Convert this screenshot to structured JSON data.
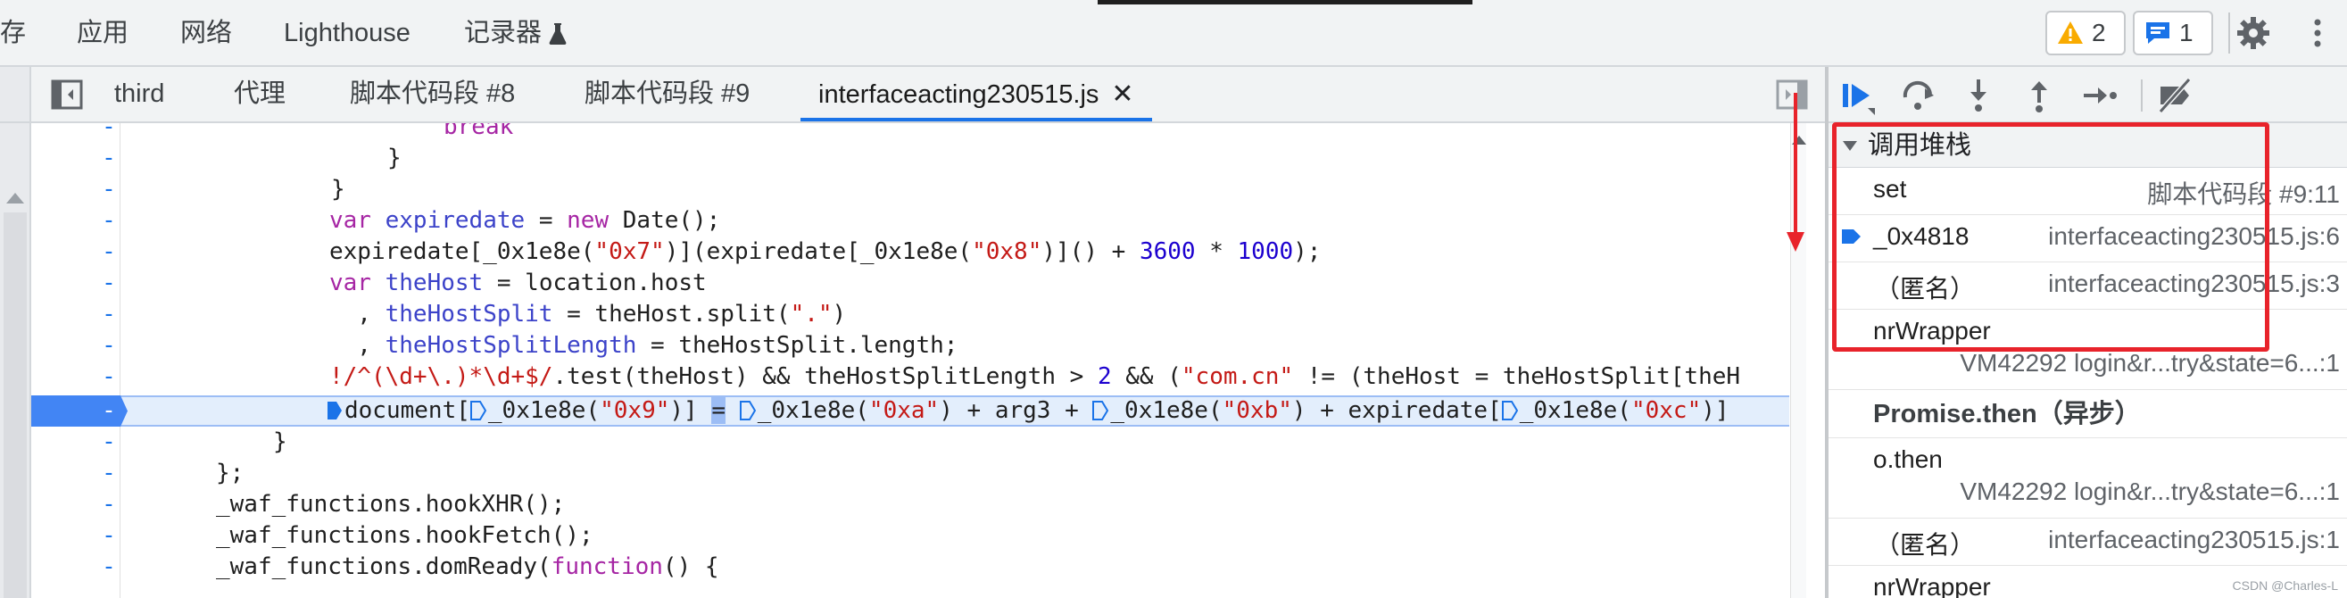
{
  "top_tabs": {
    "storage": "存",
    "application": "应用",
    "network": "网络",
    "lighthouse": "Lighthouse",
    "recorder": "记录器"
  },
  "badges": {
    "warnings": "2",
    "issues": "1"
  },
  "source_tabs": {
    "tabs": [
      "third",
      "代理",
      "脚本代码段 #8",
      "脚本代码段 #9",
      "interfaceacting230515.js"
    ],
    "active_index": 4
  },
  "code": {
    "gutter_marker": "-",
    "line_break": "break",
    "line_close1": "}",
    "line_close2": "}",
    "line_close3": "}",
    "line_close4": "};",
    "expiredate_kw": "var",
    "expiredate_name": "expiredate",
    "expiredate_rest1": " = ",
    "expiredate_new": "new",
    "expiredate_rest2": " Date();",
    "set_a": "expiredate[_0x1e8e(",
    "set_s1": "\"0x7\"",
    "set_b": ")](expiredate[_0x1e8e(",
    "set_s2": "\"0x8\"",
    "set_c": ")]() + ",
    "set_n1": "3600",
    "set_d": " * ",
    "set_n2": "1000",
    "set_e": ");",
    "host_kw": "var",
    "host_name": "theHost",
    "host_rest": " = location.host",
    "split_pre": "  , ",
    "split_name": "theHostSplit",
    "split_a": " = theHost.split(",
    "split_s": "\".\"",
    "split_b": ")",
    "len_pre": "  , ",
    "len_name": "theHostSplitLength",
    "len_rest": " = theHostSplit.length;",
    "re_bang": "!",
    "re_body": "/^(\\d+\\.)*\\d+$/",
    "re_a": ".test(theHost) && theHostSplitLength > ",
    "re_n": "2",
    "re_b": " && (",
    "re_s": "\"com.cn\"",
    "re_c": " != (theHost = theHostSplit[theH",
    "doc_a": "document[",
    "doc_b": "_0x1e8e(",
    "doc_s1": "\"0x9\"",
    "doc_c": ")] ",
    "doc_eq": "=",
    "doc_d": " ",
    "doc_e": "_0x1e8e(",
    "doc_s2": "\"0xa\"",
    "doc_f": ") + arg3 + ",
    "doc_g": "_0x1e8e(",
    "doc_s3": "\"0xb\"",
    "doc_h": ") + expiredate[",
    "doc_i": "_0x1e8e(",
    "doc_s4": "\"0xc\"",
    "doc_j": ")]",
    "hook_xhr": "_waf_functions.hookXHR();",
    "hook_fetch": "_waf_functions.hookFetch();",
    "dom_a": "_waf_functions.domReady(",
    "dom_kw": "function",
    "dom_b": "() {"
  },
  "callstack": {
    "title": "调用堆栈",
    "frames": [
      {
        "name": "set",
        "location": "脚本代码段 #9:11"
      },
      {
        "name": "_0x4818",
        "location": "interfaceacting230515.js:6"
      },
      {
        "name": "（匿名）",
        "location": "interfaceacting230515.js:3"
      },
      {
        "name": "nrWrapper",
        "location": "VM42292 login&r...try&state=6...:1"
      }
    ],
    "async_label": "Promise.then（异步）",
    "async_frames": [
      {
        "name": "o.then",
        "location": "VM42292 login&r...try&state=6...:1"
      },
      {
        "name": "（匿名）",
        "location": "interfaceacting230515.js:1"
      },
      {
        "name": "nrWrapper",
        "location": ""
      }
    ]
  },
  "watermark": "CSDN @Charles-L",
  "colors": {
    "accent": "#1a73e8",
    "annotation_red": "#e8232b",
    "warning": "#f9ab00",
    "highlight_row": "#e3eefc"
  },
  "icons": [
    "flask-icon",
    "warning-icon",
    "issues-icon",
    "gear-icon",
    "more-vert-icon",
    "close-icon",
    "panel-toggle-icon",
    "resume-icon",
    "step-over-icon",
    "step-into-icon",
    "step-out-icon",
    "step-icon",
    "deactivate-breakpoints-icon",
    "current-frame-arrow-icon"
  ]
}
